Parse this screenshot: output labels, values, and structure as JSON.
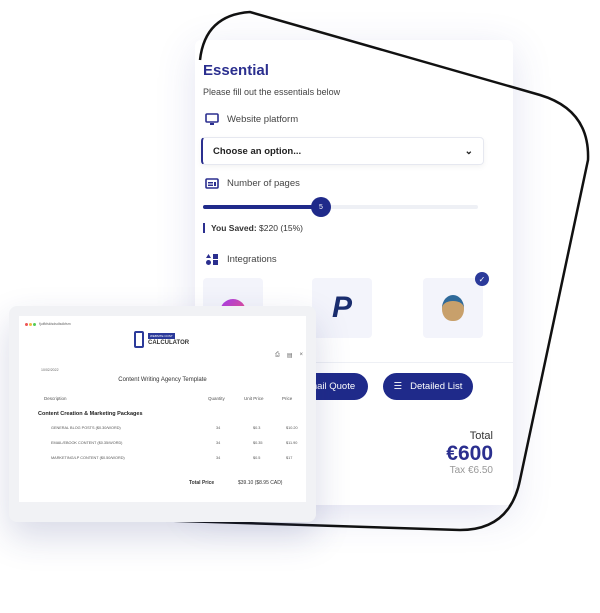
{
  "form": {
    "title": "Essential",
    "subtitle": "Please fill out the essentials below",
    "platform_label": "Website platform",
    "platform_select": "Choose an option...",
    "pages_label": "Number of pages",
    "pages_value": "5",
    "pages_fraction": 0.4,
    "saved_label": "You Saved:",
    "saved_value": "$220 (15%)",
    "integrations_label": "Integrations",
    "integrations": [
      {
        "name": "Messenger",
        "selected": false
      },
      {
        "name": "PayPal",
        "selected": false
      },
      {
        "name": "Mailchimp",
        "selected": true
      }
    ],
    "email_quote": "Email Quote",
    "detailed_list": "Detailed List",
    "total_label": "Total",
    "total_value": "€600",
    "tax": "Tax €6.50",
    "accent": "#1f2a8a"
  },
  "invoice": {
    "url": "fjuifkfsklsdsdlsdkfsm",
    "logo_badge": "WEBSITE COST",
    "logo_text": "CALCULATOR",
    "date": "10/02/2022",
    "title": "Content Writing Agency Template",
    "columns": [
      "Description",
      "Quantity",
      "Unit Price",
      "Price"
    ],
    "section": "Content Creation & Marketing Packages",
    "rows": [
      {
        "desc": "GENERAL BLOG POSTS ($0.30/WORD)",
        "qty": "34",
        "unit": "$0.3",
        "price": "$10.20"
      },
      {
        "desc": "EMAIL/EBOOK CONTENT ($0.35/WORD)",
        "qty": "34",
        "unit": "$0.35",
        "price": "$11.90"
      },
      {
        "desc": "MARKETING/LP CONTENT ($0.50/WORD)",
        "qty": "34",
        "unit": "$0.5",
        "price": "$17"
      }
    ],
    "total_label": "Total Price",
    "total_value": "$39.10 ($8.95 CAD)"
  }
}
